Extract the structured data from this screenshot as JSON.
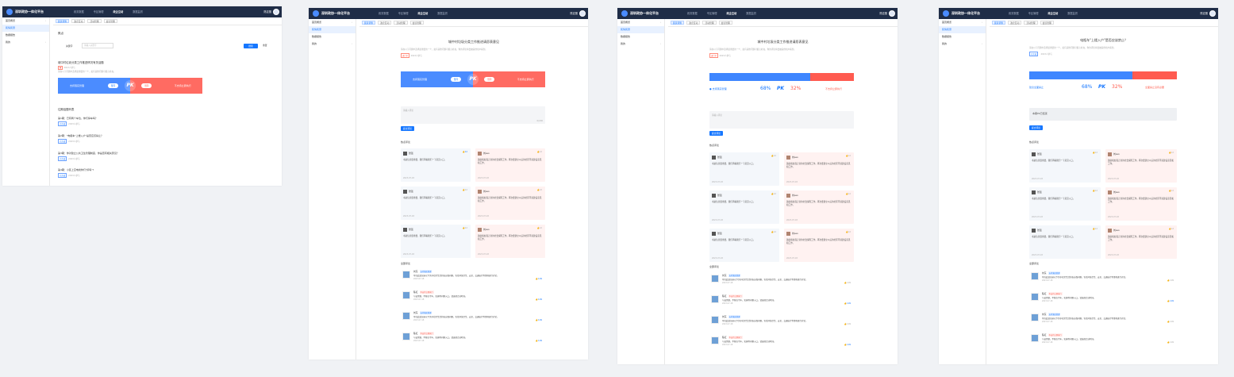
{
  "app": {
    "brand": "深圳政协一体化平台",
    "user": "陈嘉丽"
  },
  "nav": [
    "政务数据",
    "专区管理",
    "政企互动",
    "数据监督"
  ],
  "sidebar": [
    {
      "label": "首页概览"
    },
    {
      "label": "民情民意"
    },
    {
      "label": "数据报告"
    },
    {
      "label": "我的"
    }
  ],
  "tabs": [
    "民意调查",
    "政企互动",
    "活动管理",
    "会议管理"
  ],
  "panel1": {
    "title": "焦点",
    "filter_label": "关键字",
    "search_placeholder": "请输入关键字",
    "search_btn": "搜索",
    "reset_btn": "重置",
    "topic": "城中村垃圾分类工作推进情况有关话题",
    "topic_meta": "2023人参与",
    "topic_desc": "请在以下问题中选择最重要的一个，如有其他问题可留言补充。",
    "pk_left": "支持落实管理",
    "pk_left_btn": "赞同",
    "pk_right_btn": "赞同",
    "pk_right": "不支持立即执行",
    "pk": "PK",
    "history_title": "往期话题列表",
    "history": [
      {
        "title": "第1期：已有两个车位，你们停车吗？",
        "badge": "已完成",
        "meta": "2023人参与"
      },
      {
        "title": "第2期：\"电瓶车\"上楼入户\"是否应该禁止？",
        "badge": "已完成",
        "meta": "2023人参与"
      },
      {
        "title": "第3期：你对建立公共卫生管理制度，你是否有相关意见？",
        "badge": "已完成",
        "meta": "2023人参与"
      },
      {
        "title": "第4期：小区上空电线你们\"拆吗\"?",
        "badge": "已完成",
        "meta": "2023人参与"
      }
    ]
  },
  "panel2": {
    "title": "城中村垃圾分类工作推进请愿表意见",
    "desc": "请在以下问题中选择最重要的一个，如有其他问题可留言补充，你的评论将会被其他用户看到。",
    "badge": "进行中",
    "meta": "2023人参与",
    "pk_left": "支持落实管理",
    "pk_left_btn": "赞同",
    "pk_right_btn": "赞同",
    "pk_right": "不支持立即执行",
    "pk": "PK",
    "input_placeholder": "请输入评论",
    "submit": "提交评论",
    "hot_title": "热点评论",
    "count": "0/200",
    "comments": [
      {
        "name": "张强",
        "likes": "12",
        "text": "书桌信息很重要，我们再看我们一下意见入口。",
        "date": "2023-07-18"
      },
      {
        "name": "刘Leo",
        "likes": "12",
        "text": "鼓励和加强正常的社会保障工作。再次要建立以后的社区环境建设意见和工作。",
        "date": "2023-07-18"
      },
      {
        "name": "张强",
        "likes": "12",
        "text": "书桌信息很重要，我们再看我们一下意见入口。",
        "date": "2023-07-18"
      },
      {
        "name": "刘Leo",
        "likes": "12",
        "text": "鼓励和加强正常的社会保障工作。再次要建立以后的社区环境建设意见和工作。",
        "date": "2023-07-18"
      },
      {
        "name": "张强",
        "likes": "12",
        "text": "书桌信息很重要，我们再看我们一下意见入口。",
        "date": "2023-07-18"
      },
      {
        "name": "刘Leo",
        "likes": "12",
        "text": "鼓励和加强正常的社会保障工作。再次要建立以后的社区环境建设意见和工作。",
        "date": "2023-07-18"
      }
    ],
    "all_title": "全部评论",
    "msgs": [
      {
        "name": "刘东",
        "tag": "支持落实管理",
        "tagc": "b",
        "text": "可在此处记录以下关于社区生活的各方面问题，包括环境卫生、安全、交通出行等事项进行讨论。",
        "date": "2023-07-18",
        "likes": "109"
      },
      {
        "name": "陈红",
        "tag": "不支持立即执行",
        "tagc": "r",
        "text": "与该需要，不能在今年，实施等问题入口，请选择合适时间。",
        "date": "2023-07-18",
        "likes": "109"
      },
      {
        "name": "刘东",
        "tag": "支持落实管理",
        "tagc": "b",
        "text": "可在此处记录以下关于社区生活的各方面问题，包括环境卫生、安全、交通出行等事项进行讨论。",
        "date": "2023-07-18",
        "likes": "109"
      },
      {
        "name": "陈红",
        "tag": "不支持立即执行",
        "tagc": "r",
        "text": "与该需要，不能在今年，实施等问题入口，请选择合适时间。",
        "date": "2023-07-18",
        "likes": "109"
      }
    ]
  },
  "panel3": {
    "title": "城中村垃圾分类工作推进请愿表意见",
    "desc": "请在以下问题中选择最重要的一个，如有其他问题可留言补充，你的评论将会被其他用户看到。",
    "badge": "进行中",
    "meta": "2023人参与",
    "left": "支持落实管理",
    "pct_left": "68%",
    "pk": "PK",
    "pct_right": "32%",
    "right": "不支持立即执行",
    "input_placeholder": "请输入评论",
    "submit": "提交评论",
    "hot_title": "热点评论",
    "all_title": "全部评论"
  },
  "panel4": {
    "title": "电瓶车\"上楼入户\"是否应该禁止？",
    "desc": "请在以下问题中选择最重要的一个，如有其他问题可留言补充，你的评论将会被其他用户看到。",
    "badge": "已完成",
    "meta": "2023人参与",
    "left": "建议全面禁止",
    "pct_left": "68%",
    "pk": "PK",
    "pct_right": "32%",
    "right": "全面禁止没有必要",
    "closed": "本期PK已结束",
    "submit": "提交评论",
    "hot_title": "热点评论",
    "all_title": "全部评论"
  }
}
